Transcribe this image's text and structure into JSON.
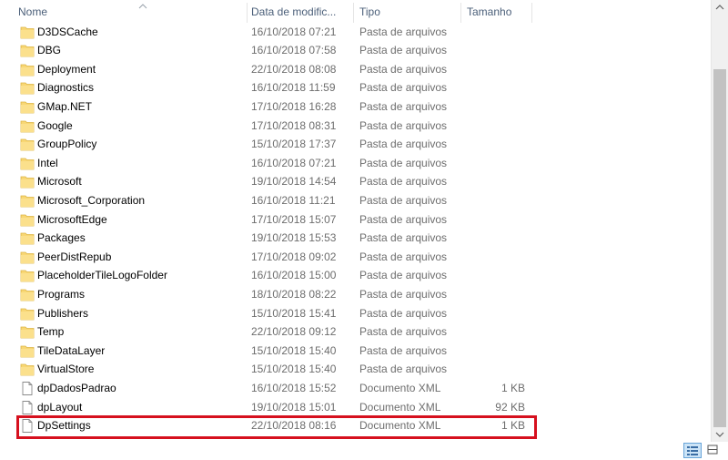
{
  "columns": {
    "name": "Nome",
    "date": "Data de modific...",
    "type": "Tipo",
    "size": "Tamanho"
  },
  "rows": [
    {
      "name": "D3DSCache",
      "date": "16/10/2018 07:21",
      "type": "Pasta de arquivos",
      "size": "",
      "icon": "folder-icon"
    },
    {
      "name": "DBG",
      "date": "16/10/2018 07:58",
      "type": "Pasta de arquivos",
      "size": "",
      "icon": "folder-icon"
    },
    {
      "name": "Deployment",
      "date": "22/10/2018 08:08",
      "type": "Pasta de arquivos",
      "size": "",
      "icon": "folder-icon"
    },
    {
      "name": "Diagnostics",
      "date": "16/10/2018 11:59",
      "type": "Pasta de arquivos",
      "size": "",
      "icon": "folder-icon"
    },
    {
      "name": "GMap.NET",
      "date": "17/10/2018 16:28",
      "type": "Pasta de arquivos",
      "size": "",
      "icon": "folder-icon"
    },
    {
      "name": "Google",
      "date": "17/10/2018 08:31",
      "type": "Pasta de arquivos",
      "size": "",
      "icon": "folder-icon"
    },
    {
      "name": "GroupPolicy",
      "date": "15/10/2018 17:37",
      "type": "Pasta de arquivos",
      "size": "",
      "icon": "folder-icon"
    },
    {
      "name": "Intel",
      "date": "16/10/2018 07:21",
      "type": "Pasta de arquivos",
      "size": "",
      "icon": "folder-icon"
    },
    {
      "name": "Microsoft",
      "date": "19/10/2018 14:54",
      "type": "Pasta de arquivos",
      "size": "",
      "icon": "folder-icon"
    },
    {
      "name": "Microsoft_Corporation",
      "date": "16/10/2018 11:21",
      "type": "Pasta de arquivos",
      "size": "",
      "icon": "folder-icon"
    },
    {
      "name": "MicrosoftEdge",
      "date": "17/10/2018 15:07",
      "type": "Pasta de arquivos",
      "size": "",
      "icon": "folder-icon"
    },
    {
      "name": "Packages",
      "date": "19/10/2018 15:53",
      "type": "Pasta de arquivos",
      "size": "",
      "icon": "folder-icon"
    },
    {
      "name": "PeerDistRepub",
      "date": "17/10/2018 09:02",
      "type": "Pasta de arquivos",
      "size": "",
      "icon": "folder-icon"
    },
    {
      "name": "PlaceholderTileLogoFolder",
      "date": "16/10/2018 15:00",
      "type": "Pasta de arquivos",
      "size": "",
      "icon": "folder-icon"
    },
    {
      "name": "Programs",
      "date": "18/10/2018 08:22",
      "type": "Pasta de arquivos",
      "size": "",
      "icon": "folder-icon"
    },
    {
      "name": "Publishers",
      "date": "15/10/2018 15:41",
      "type": "Pasta de arquivos",
      "size": "",
      "icon": "folder-icon"
    },
    {
      "name": "Temp",
      "date": "22/10/2018 09:12",
      "type": "Pasta de arquivos",
      "size": "",
      "icon": "folder-icon"
    },
    {
      "name": "TileDataLayer",
      "date": "15/10/2018 15:40",
      "type": "Pasta de arquivos",
      "size": "",
      "icon": "folder-icon"
    },
    {
      "name": "VirtualStore",
      "date": "15/10/2018 15:40",
      "type": "Pasta de arquivos",
      "size": "",
      "icon": "folder-icon"
    },
    {
      "name": "dpDadosPadrao",
      "date": "16/10/2018 15:52",
      "type": "Documento XML",
      "size": "1 KB",
      "icon": "document-icon"
    },
    {
      "name": "dpLayout",
      "date": "19/10/2018 15:01",
      "type": "Documento XML",
      "size": "92 KB",
      "icon": "document-icon"
    },
    {
      "name": "DpSettings",
      "date": "22/10/2018 08:16",
      "type": "Documento XML",
      "size": "1 KB",
      "icon": "document-icon"
    }
  ],
  "colors": {
    "highlight": "#d6101e",
    "folder": "#f8d775",
    "header_text": "#4c607a",
    "detail_text": "#6d6d6d"
  }
}
